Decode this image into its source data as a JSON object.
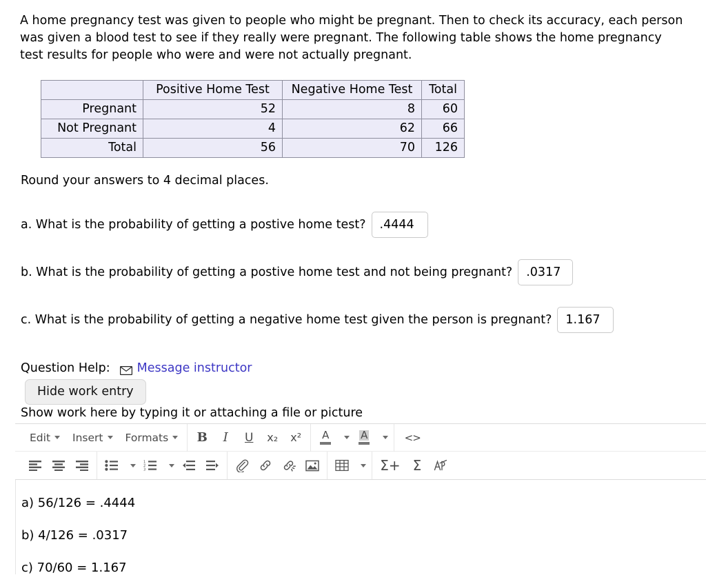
{
  "intro": {
    "paragraph": "A home pregnancy test was given to people who might be pregnant. Then to check its accuracy, each person was given a blood test to see if they really were pregnant. The following table shows the home pregnancy test results for people who were and were not actually pregnant."
  },
  "table": {
    "corner_label": "",
    "column_headers": [
      "Positive Home Test",
      "Negative Home Test",
      "Total"
    ],
    "rows": [
      {
        "label": "Pregnant",
        "cells": [
          "52",
          "8",
          "60"
        ]
      },
      {
        "label": "Not Pregnant",
        "cells": [
          "4",
          "62",
          "66"
        ]
      },
      {
        "label": "Total",
        "cells": [
          "56",
          "70",
          "126"
        ]
      }
    ]
  },
  "round_note": "Round your answers to 4 decimal places.",
  "questions": [
    {
      "id": "a",
      "text": "a. What is the probability of getting a postive home test?",
      "answer": ".4444",
      "placeholder": ""
    },
    {
      "id": "b",
      "text": "b. What is the probability of getting a postive home test and not being pregnant?",
      "answer": ".0317",
      "placeholder": ""
    },
    {
      "id": "c",
      "text": "c. What is the probability of getting a negative home test given the person is pregnant?",
      "answer": "1.167",
      "placeholder": ""
    }
  ],
  "question_help": {
    "label": "Question Help:",
    "message_link": "Message instructor",
    "envelope_icon": "envelope-icon",
    "link_color": "#3c36c4"
  },
  "hide_work_button": "Hide work entry",
  "show_work_caption": "Show work here by typing it or attaching a file or picture",
  "editor": {
    "menus": [
      {
        "label": "Edit",
        "icon": "chevron-down-icon"
      },
      {
        "label": "Insert",
        "icon": "chevron-down-icon"
      },
      {
        "label": "Formats",
        "icon": "chevron-down-icon"
      }
    ],
    "row1_buttons": [
      {
        "name": "bold-icon",
        "glyph": "B"
      },
      {
        "name": "italic-icon",
        "glyph": "I"
      },
      {
        "name": "underline-icon",
        "glyph": "U"
      },
      {
        "name": "subscript-icon",
        "glyph": "x₂"
      },
      {
        "name": "superscript-icon",
        "glyph": "x²"
      },
      {
        "name": "text-color-icon",
        "glyph": "A"
      },
      {
        "name": "background-color-icon",
        "glyph": "A"
      },
      {
        "name": "source-code-icon",
        "glyph": "<>"
      }
    ],
    "row2_buttons": [
      {
        "name": "align-left-icon"
      },
      {
        "name": "align-center-icon"
      },
      {
        "name": "align-right-icon"
      },
      {
        "name": "bullet-list-icon"
      },
      {
        "name": "numbered-list-icon"
      },
      {
        "name": "decrease-indent-icon"
      },
      {
        "name": "increase-indent-icon"
      },
      {
        "name": "attachment-icon"
      },
      {
        "name": "link-icon"
      },
      {
        "name": "unlink-icon"
      },
      {
        "name": "image-icon"
      },
      {
        "name": "table-icon"
      },
      {
        "name": "insert-equation-icon",
        "glyph": "Σ+"
      },
      {
        "name": "math-sigma-icon",
        "glyph": "Σ"
      },
      {
        "name": "special-character-icon",
        "glyph": "A̶"
      }
    ]
  },
  "work_entry": {
    "lines": [
      "a) 56/126 = .4444",
      "b) 4/126 = .0317",
      "c) 70/60 = 1.167"
    ]
  }
}
